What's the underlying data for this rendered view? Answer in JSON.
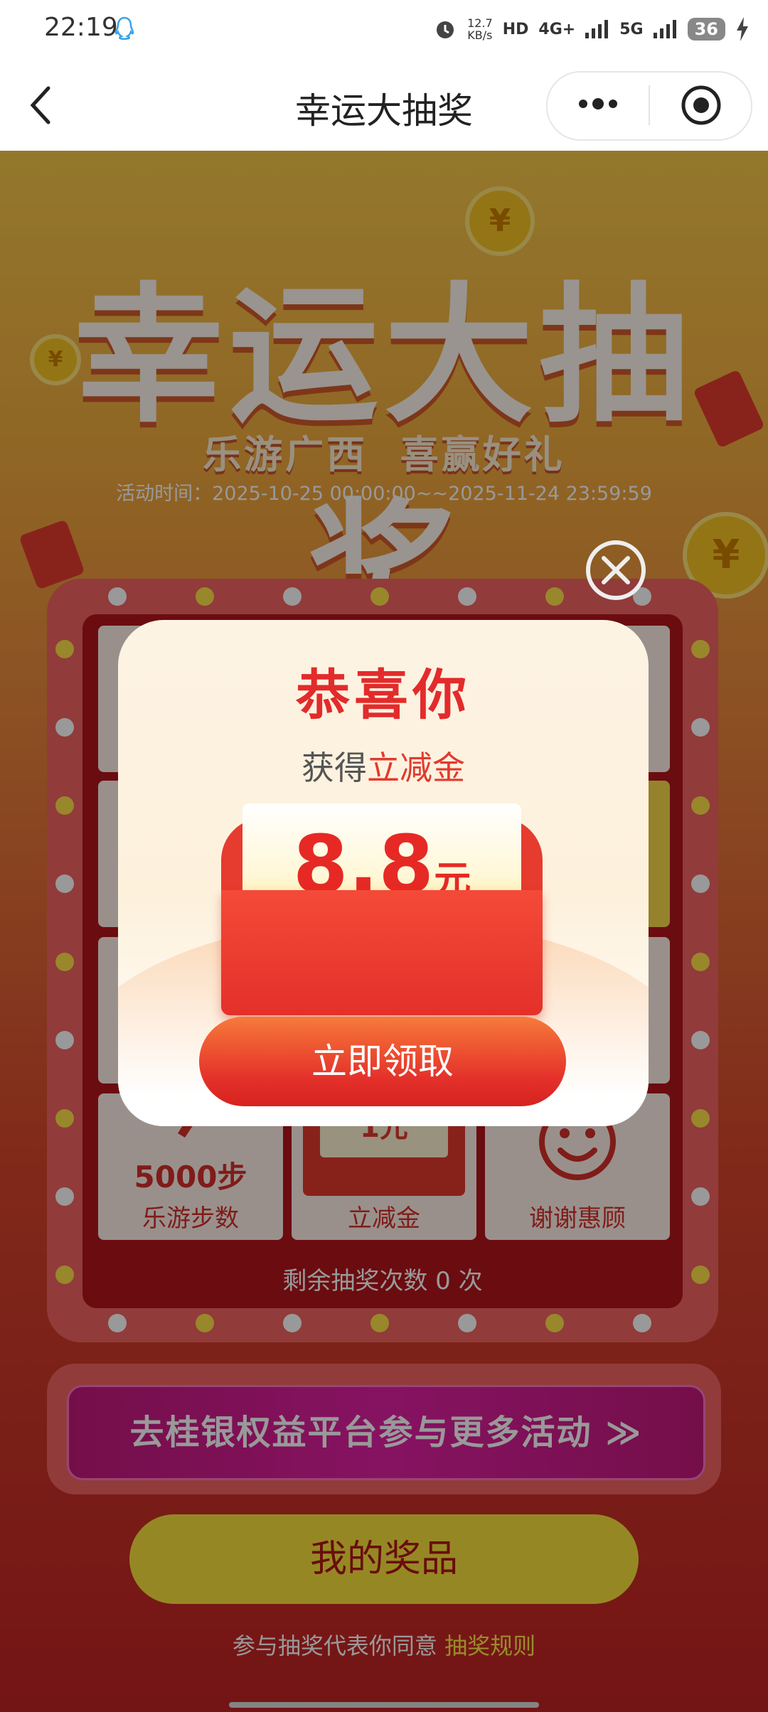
{
  "status_bar": {
    "time": "22:19",
    "speed_value": "12.7",
    "speed_unit": "KB/s",
    "hd": "HD",
    "net1": "4G+",
    "net2": "5G",
    "battery": "36"
  },
  "nav": {
    "title": "幸运大抽奖"
  },
  "hero": {
    "title": "幸运大抽奖",
    "subtitle": "乐游广西  喜赢好礼",
    "time": "活动时间：2025-10-25 00:00:00~~2025-11-24 23:59:59"
  },
  "board": {
    "cells": [
      {
        "value": "5000步",
        "label": "乐游步数"
      },
      {
        "value": "1元",
        "label": "立减金"
      },
      {
        "value": "",
        "label": "谢谢惠顾"
      }
    ],
    "remaining": "剩余抽奖次数 0 次"
  },
  "link_banner": {
    "text": "去桂银权益平台参与更多活动 ≫"
  },
  "prize_button": "我的奖品",
  "agreement": {
    "prefix": "参与抽奖代表你同意 ",
    "rule_link": "抽奖规则"
  },
  "modal": {
    "title": "恭喜你",
    "won_prefix": "获得",
    "won_item": "立减金",
    "amount": "8.8",
    "unit": "元",
    "claim_button": "立即领取"
  },
  "colors": {
    "accent_red": "#e32b2b",
    "gold": "#f9e33c",
    "board_red": "#b2151c"
  }
}
